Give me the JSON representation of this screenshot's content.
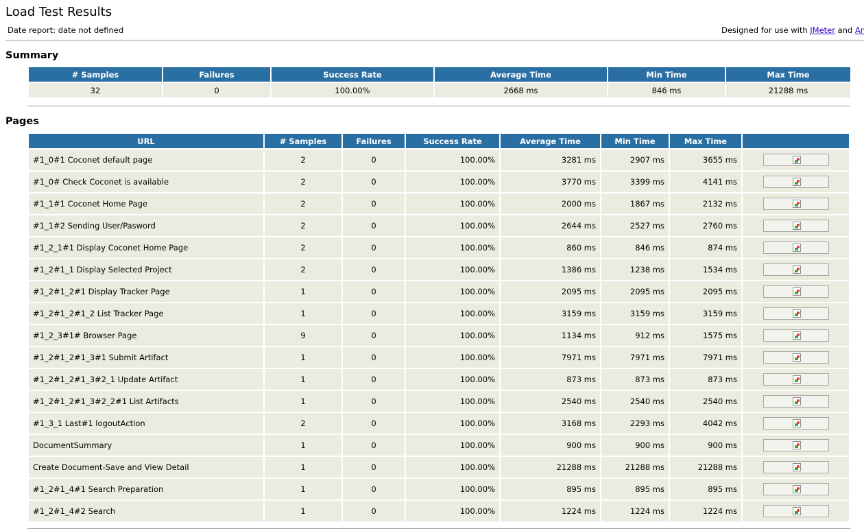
{
  "header": {
    "title": "Load Test Results",
    "date_report": "Date report: date not defined",
    "designed_prefix": "Designed for use with ",
    "jmeter_link": "JMeter",
    "and_text": " and ",
    "ant_link": "Ant"
  },
  "summary": {
    "heading": "Summary",
    "columns": [
      "# Samples",
      "Failures",
      "Success Rate",
      "Average Time",
      "Min Time",
      "Max Time"
    ],
    "row": [
      "32",
      "0",
      "100.00%",
      "2668 ms",
      "846 ms",
      "21288 ms"
    ]
  },
  "pages": {
    "heading": "Pages",
    "columns": [
      "URL",
      "# Samples",
      "Failures",
      "Success Rate",
      "Average Time",
      "Min Time",
      "Max Time",
      ""
    ],
    "rows": [
      [
        "#1_0#1 Coconet default page",
        "2",
        "0",
        "100.00%",
        "3281 ms",
        "2907 ms",
        "3655 ms"
      ],
      [
        "#1_0# Check Coconet is available",
        "2",
        "0",
        "100.00%",
        "3770 ms",
        "3399 ms",
        "4141 ms"
      ],
      [
        "#1_1#1 Coconet Home Page",
        "2",
        "0",
        "100.00%",
        "2000 ms",
        "1867 ms",
        "2132 ms"
      ],
      [
        "#1_1#2 Sending User/Pasword",
        "2",
        "0",
        "100.00%",
        "2644 ms",
        "2527 ms",
        "2760 ms"
      ],
      [
        "#1_2_1#1 Display Coconet Home Page",
        "2",
        "0",
        "100.00%",
        "860 ms",
        "846 ms",
        "874 ms"
      ],
      [
        "#1_2#1_1 Display Selected Project",
        "2",
        "0",
        "100.00%",
        "1386 ms",
        "1238 ms",
        "1534 ms"
      ],
      [
        "#1_2#1_2#1 Display Tracker Page",
        "1",
        "0",
        "100.00%",
        "2095 ms",
        "2095 ms",
        "2095 ms"
      ],
      [
        "#1_2#1_2#1_2 List Tracker Page",
        "1",
        "0",
        "100.00%",
        "3159 ms",
        "3159 ms",
        "3159 ms"
      ],
      [
        "#1_2_3#1# Browser Page",
        "9",
        "0",
        "100.00%",
        "1134 ms",
        "912 ms",
        "1575 ms"
      ],
      [
        "#1_2#1_2#1_3#1 Submit Artifact",
        "1",
        "0",
        "100.00%",
        "7971 ms",
        "7971 ms",
        "7971 ms"
      ],
      [
        "#1_2#1_2#1_3#2_1 Update Artifact",
        "1",
        "0",
        "100.00%",
        "873 ms",
        "873 ms",
        "873 ms"
      ],
      [
        "#1_2#1_2#1_3#2_2#1 List Artifacts",
        "1",
        "0",
        "100.00%",
        "2540 ms",
        "2540 ms",
        "2540 ms"
      ],
      [
        "#1_3_1 Last#1 logoutAction",
        "2",
        "0",
        "100.00%",
        "3168 ms",
        "2293 ms",
        "4042 ms"
      ],
      [
        "DocumentSummary",
        "1",
        "0",
        "100.00%",
        "900 ms",
        "900 ms",
        "900 ms"
      ],
      [
        "Create Document-Save and View Detail",
        "1",
        "0",
        "100.00%",
        "21288 ms",
        "21288 ms",
        "21288 ms"
      ],
      [
        "#1_2#1_4#1 Search Preparation",
        "1",
        "0",
        "100.00%",
        "895 ms",
        "895 ms",
        "895 ms"
      ],
      [
        "#1_2#1_4#2 Search",
        "1",
        "0",
        "100.00%",
        "1224 ms",
        "1224 ms",
        "1224 ms"
      ]
    ],
    "detail_icon": "broken-image-icon"
  }
}
